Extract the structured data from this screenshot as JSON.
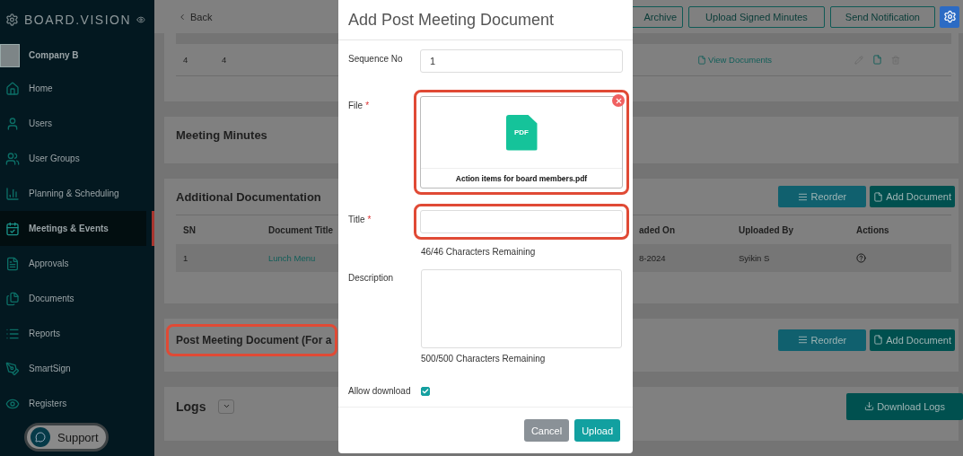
{
  "sidebar": {
    "brand": "BOARD.VISION",
    "company": "Company B",
    "items": [
      {
        "label": "Home",
        "selected": false
      },
      {
        "label": "Users",
        "selected": false
      },
      {
        "label": "User Groups",
        "selected": false
      },
      {
        "label": "Planning & Scheduling",
        "selected": false
      },
      {
        "label": "Meetings & Events",
        "selected": true
      },
      {
        "label": "Approvals",
        "selected": false
      },
      {
        "label": "Documents",
        "selected": false
      },
      {
        "label": "Reports",
        "selected": false
      },
      {
        "label": "SmartSign",
        "selected": false
      },
      {
        "label": "Registers",
        "selected": false
      }
    ],
    "support": "Support"
  },
  "topbar": {
    "back": "Back",
    "buttons": [
      "Archive",
      "Upload Signed Minutes",
      "Send Notification"
    ]
  },
  "agenda_table": {
    "rows": [
      {
        "cells": [
          "4",
          "4"
        ],
        "link": "View Documents"
      }
    ]
  },
  "meeting_minutes": {
    "title": "Meeting Minutes"
  },
  "additional_documentation": {
    "title": "Additional Documentation",
    "buttons": [
      "Reorder",
      "Add Document"
    ],
    "columns": [
      "SN",
      "Document Title",
      "aded On",
      "Uploaded By",
      "Actions"
    ],
    "rows": [
      {
        "sn": "1",
        "title": "Lunch Menu",
        "uploaded_on": "8-2024",
        "uploaded_by": "Syikin S"
      }
    ]
  },
  "post_meeting_document": {
    "title": "Post Meeting Document (For a",
    "highlighted": true,
    "buttons": [
      "Reorder",
      "Add Document"
    ]
  },
  "logs": {
    "title": "Logs",
    "button": "Download Logs"
  },
  "modal": {
    "title": "Add Post Meeting Document",
    "fields": [
      {
        "kind": "text",
        "label": "Sequence No",
        "value": "1"
      },
      {
        "kind": "file",
        "label": "File",
        "required_mark": "*",
        "file_type": "PDF",
        "file_name": "Action items for board members.pdf",
        "highlighted": true
      },
      {
        "kind": "text",
        "label": "Title",
        "required_mark": "*",
        "hint": "46/46 Characters Remaining",
        "highlighted": true
      },
      {
        "kind": "textarea",
        "label": "Description",
        "hint": "500/500 Characters Remaining"
      },
      {
        "kind": "checkbox",
        "label": "Allow download",
        "checked": true
      }
    ],
    "buttons": [
      "Cancel",
      "Upload"
    ]
  }
}
